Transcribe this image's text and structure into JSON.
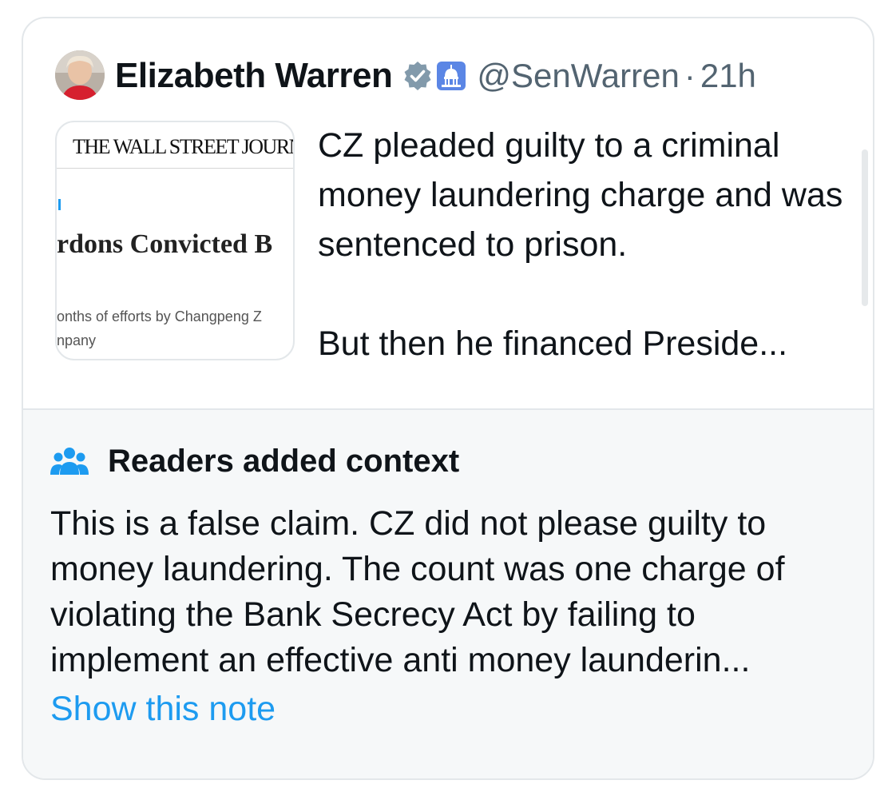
{
  "post": {
    "author_name": "Elizabeth Warren",
    "handle": "@SenWarren",
    "separator": "·",
    "time": "21h",
    "text": "CZ pleaded guilty to a criminal money laundering charge and was sentenced to prison.\n\nBut then he financed Preside...",
    "verified_icon": "verified-badge-icon",
    "affiliation_icon": "capitol-building-icon",
    "link_card": {
      "masthead": "THE WALL STREET JOURNAL",
      "headline": "rdons Convicted B",
      "subtext_line1": "onths of efforts by Changpeng Z",
      "subtext_line2": "npany"
    }
  },
  "community_note": {
    "icon": "people-icon",
    "title": "Readers added context",
    "body": "This is a false claim. CZ did not please guilty to money laundering. The count was one charge of violating the Bank Secrecy Act by failing to implement an effective anti money launderin...",
    "link_label": "Show this note"
  },
  "colors": {
    "accent": "#1d9bf0",
    "muted_text": "#536471",
    "note_background": "#f6f8f9",
    "verified_badge": "#829aab"
  }
}
